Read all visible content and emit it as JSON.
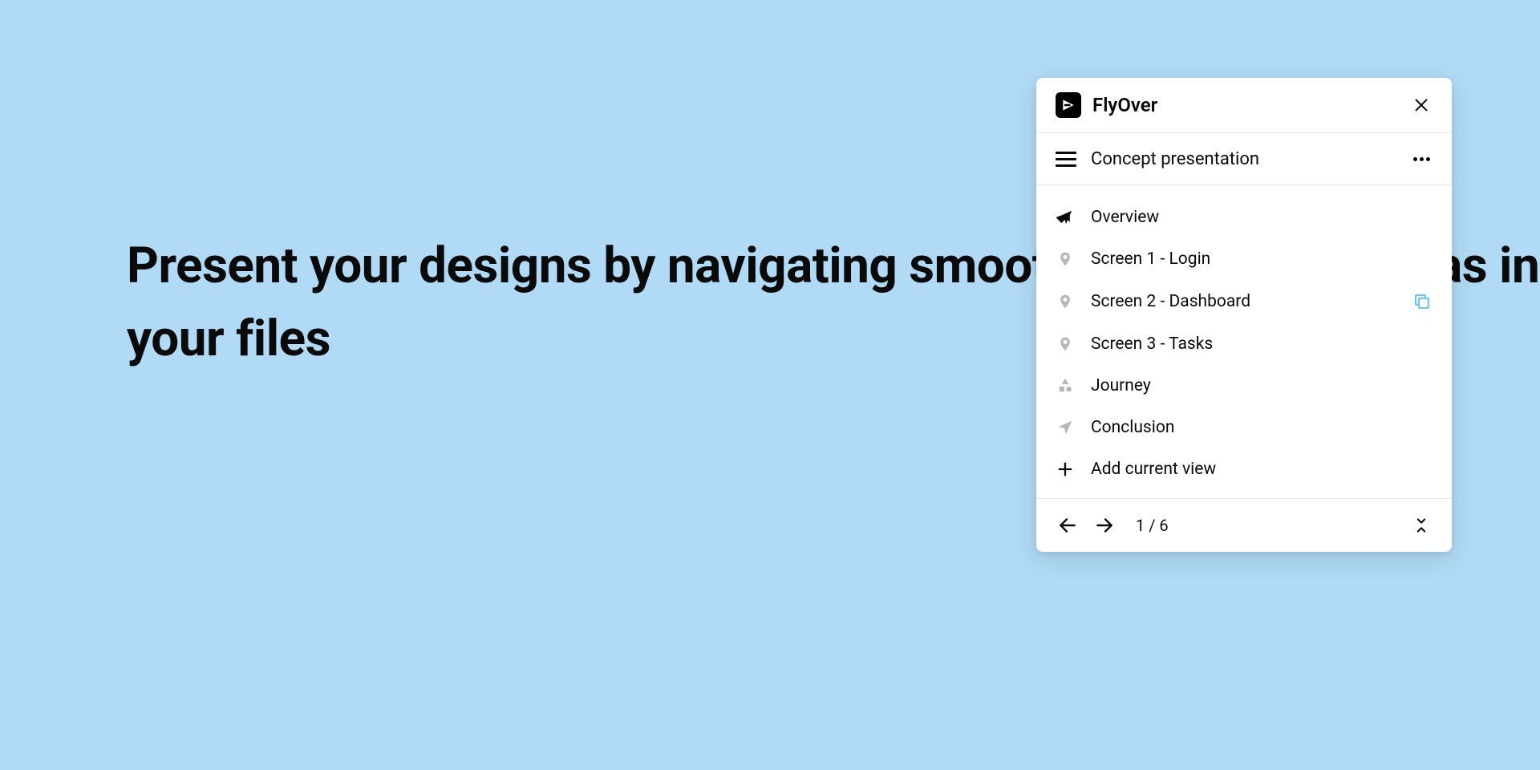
{
  "hero": {
    "text": "Present your designs by navigating smoothly to specific areas in your files"
  },
  "panel": {
    "app_name": "FlyOver",
    "presentation_title": "Concept presentation",
    "items": [
      {
        "label": "Overview",
        "icon": "arrow-filled",
        "active": true,
        "trailing": null
      },
      {
        "label": "Screen 1 - Login",
        "icon": "pin",
        "active": false,
        "trailing": null
      },
      {
        "label": "Screen 2 - Dashboard",
        "icon": "pin",
        "active": false,
        "trailing": "copy"
      },
      {
        "label": "Screen 3 - Tasks",
        "icon": "pin",
        "active": false,
        "trailing": null
      },
      {
        "label": "Journey",
        "icon": "shapes",
        "active": false,
        "trailing": null
      },
      {
        "label": "Conclusion",
        "icon": "arrow-outline",
        "active": false,
        "trailing": null
      }
    ],
    "add_label": "Add current view",
    "footer": {
      "current": 1,
      "total": 6,
      "counter_text": "1 / 6"
    }
  }
}
